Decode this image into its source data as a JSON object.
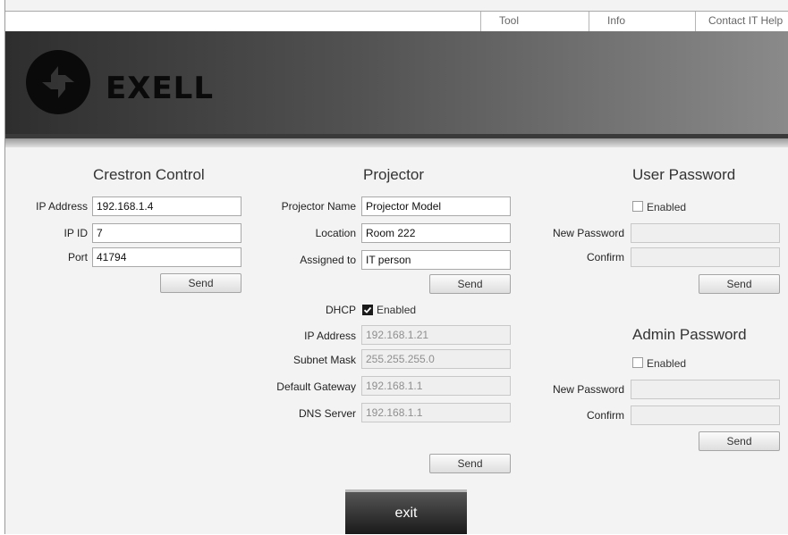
{
  "topnav": {
    "tool": "Tool",
    "info": "Info",
    "contact": "Contact IT Help"
  },
  "brand": {
    "name": "EXELL"
  },
  "crestron": {
    "title": "Crestron Control",
    "ip_label": "IP Address",
    "ip_value": "192.168.1.4",
    "ipid_label": "IP ID",
    "ipid_value": "7",
    "port_label": "Port",
    "port_value": "41794",
    "send": "Send"
  },
  "projector": {
    "title": "Projector",
    "name_label": "Projector Name",
    "name_value": "Projector Model",
    "location_label": "Location",
    "location_value": "Room 222",
    "assigned_label": "Assigned to",
    "assigned_value": "IT person",
    "send": "Send",
    "dhcp_label": "DHCP",
    "dhcp_enabled": "Enabled",
    "ip_label": "IP Address",
    "ip_value": "192.168.1.21",
    "subnet_label": "Subnet Mask",
    "subnet_value": "255.255.255.0",
    "gateway_label": "Default Gateway",
    "gateway_value": "192.168.1.1",
    "dns_label": "DNS Server",
    "dns_value": "192.168.1.1",
    "send2": "Send"
  },
  "user_password": {
    "title": "User Password",
    "enabled": "Enabled",
    "new_label": "New Password",
    "new_value": "",
    "confirm_label": "Confirm",
    "confirm_value": "",
    "send": "Send"
  },
  "admin_password": {
    "title": "Admin Password",
    "enabled": "Enabled",
    "new_label": "New Password",
    "new_value": "",
    "confirm_label": "Confirm",
    "confirm_value": "",
    "send": "Send"
  },
  "exit": "exit",
  "colors": {
    "banner_dark": "#2e2e2e",
    "banner_light": "#8a8a8a",
    "exit_bg": "#1a1a1a"
  }
}
